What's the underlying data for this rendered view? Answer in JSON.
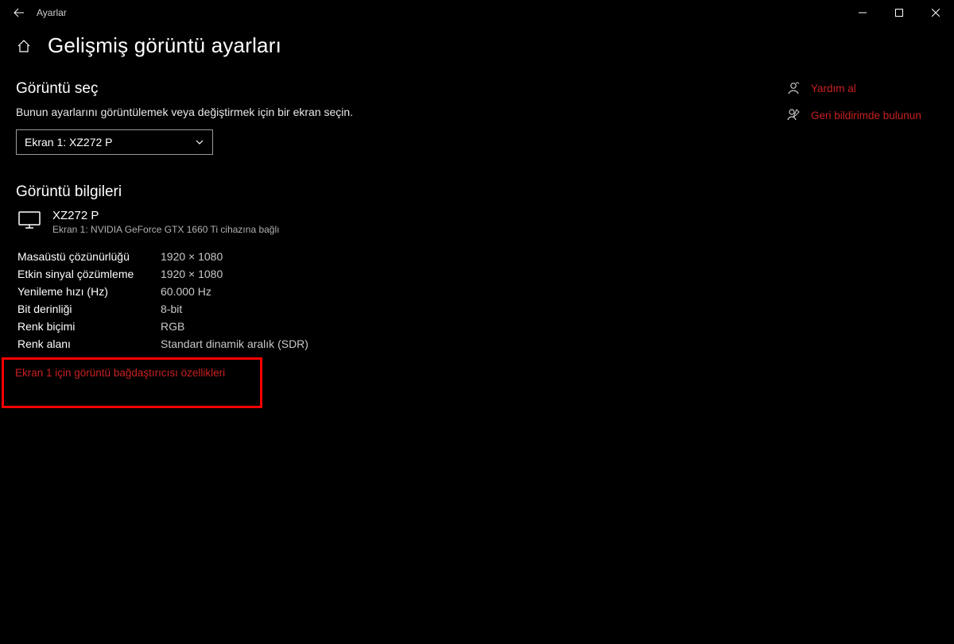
{
  "titlebar": {
    "app_name": "Ayarlar"
  },
  "header": {
    "page_title": "Gelişmiş görüntü ayarları"
  },
  "select_display": {
    "title": "Görüntü seç",
    "hint": "Bunun ayarlarını görüntülemek veya değiştirmek için bir ekran seçin.",
    "selected": "Ekran 1: XZ272 P"
  },
  "display_info": {
    "title": "Görüntü bilgileri",
    "monitor_name": "XZ272 P",
    "monitor_sub": "Ekran 1: NVIDIA GeForce GTX 1660 Ti cihazına bağlı",
    "rows": [
      {
        "k": "Masaüstü çözünürlüğü",
        "v": "1920 × 1080"
      },
      {
        "k": "Etkin sinyal çözümleme",
        "v": "1920 × 1080"
      },
      {
        "k": "Yenileme hızı (Hz)",
        "v": "60.000 Hz"
      },
      {
        "k": "Bit derinliği",
        "v": "8-bit"
      },
      {
        "k": "Renk biçimi",
        "v": "RGB"
      },
      {
        "k": "Renk alanı",
        "v": "Standart dinamik aralık (SDR)"
      }
    ],
    "adapter_link": "Ekran 1 için görüntü bağdaştırıcısı özellikleri"
  },
  "side": {
    "help": "Yardım al",
    "feedback": "Geri bildirimde bulunun"
  }
}
